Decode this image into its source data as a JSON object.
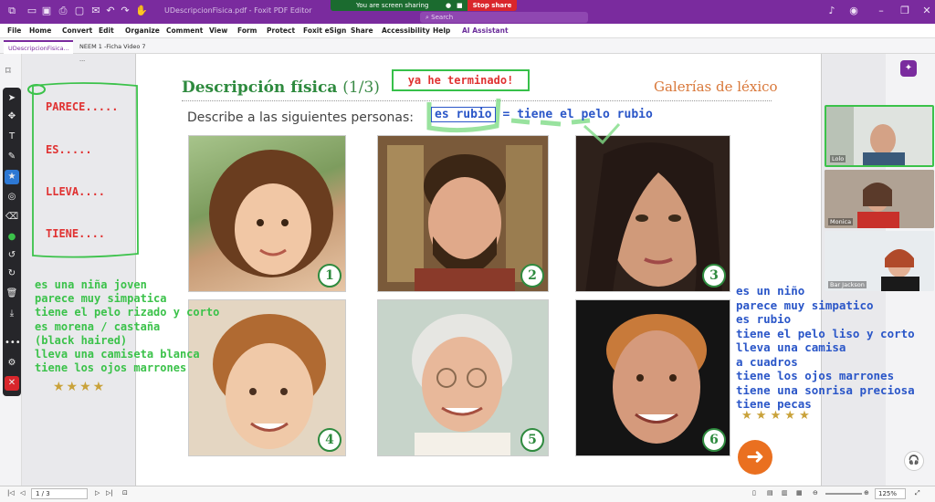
{
  "app": {
    "doc_title": "UDescripcionFisica.pdf - Foxit PDF Editor",
    "search_placeholder": "Search"
  },
  "screen_share": {
    "status": "You are screen sharing",
    "stop_label": "Stop share"
  },
  "menu": [
    "File",
    "Home",
    "Convert",
    "Edit",
    "Organize",
    "Comment",
    "View",
    "Form",
    "Protect",
    "Foxit eSign",
    "Share",
    "Accessibility",
    "Help",
    "AI Assistant"
  ],
  "tabs": [
    {
      "label": "UDescripcionFisica..."
    },
    {
      "label": "NEEM 1 -Ficha Video  7 ..."
    }
  ],
  "page": {
    "heading": "Descripción física",
    "heading_num": "(1/3)",
    "gallery": "Galerías de léxico",
    "instruction": "Describe a las siguientes personas:",
    "photo_numbers": [
      "1",
      "2",
      "3",
      "4",
      "5",
      "6"
    ]
  },
  "annotations": {
    "done_note": "ya he terminado!",
    "rubio_word": "es rubio",
    "rubio_rest": "= tiene el pelo rubio",
    "red_prompts": [
      "PARECE.....",
      "ES.....",
      "LLEVA....",
      "TIENE...."
    ],
    "green_lines": [
      "es una niña joven",
      "parece muy simpatica",
      "tiene el pelo rizado y corto",
      "es morena / castaña",
      "(black haired)",
      "lleva una camiseta blanca",
      "tiene los ojos marrones"
    ],
    "blue_lines": [
      "es un niño",
      "parece muy simpatico",
      "es rubio",
      "tiene el pelo liso y corto",
      "lleva una camisa",
      "a cuadros",
      "tiene los ojos marrones",
      "tiene una sonrisa preciosa",
      "tiene pecas"
    ],
    "stars_left": "★★★★",
    "stars_right": "★   ★   ★   ★   ★"
  },
  "video": {
    "participants": [
      "Lolo",
      "Monica",
      "Bar Jackson"
    ]
  },
  "status_bar": {
    "page_value": "1 / 3",
    "zoom": "125%"
  },
  "colors": {
    "titlebar": "#7a2b9e",
    "heading_green": "#2e8a3e",
    "gallery_orange": "#d9783a",
    "annotation_red": "#e03232",
    "annotation_green": "#3bc24a",
    "annotation_blue": "#2a56c8"
  }
}
